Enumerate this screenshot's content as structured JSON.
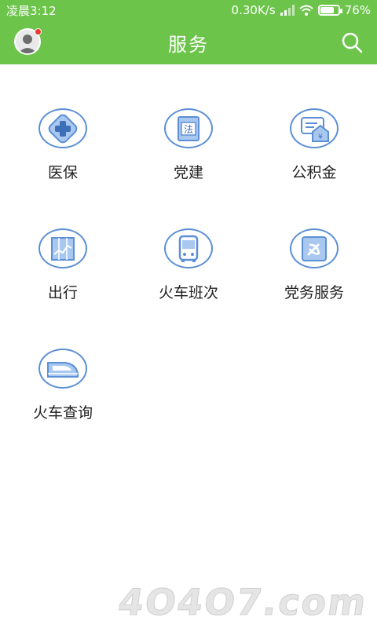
{
  "status": {
    "time": "凌晨3:12",
    "speed": "0.30K/s",
    "battery": "76%"
  },
  "appbar": {
    "title": "服务"
  },
  "services": [
    {
      "label": "医保",
      "icon": "medical-cross-icon"
    },
    {
      "label": "党建",
      "icon": "law-book-icon"
    },
    {
      "label": "公积金",
      "icon": "housing-fund-icon"
    },
    {
      "label": "出行",
      "icon": "travel-chart-icon"
    },
    {
      "label": "火车班次",
      "icon": "bus-icon"
    },
    {
      "label": "党务服务",
      "icon": "party-emblem-icon"
    },
    {
      "label": "火车查询",
      "icon": "bullet-train-icon"
    }
  ],
  "colors": {
    "green": "#6cc44b",
    "iconBlue": "#5b8fd6",
    "iconFill": "#a8c8f0",
    "badge": "#e63a2e"
  },
  "watermark": "4O4O7.com"
}
